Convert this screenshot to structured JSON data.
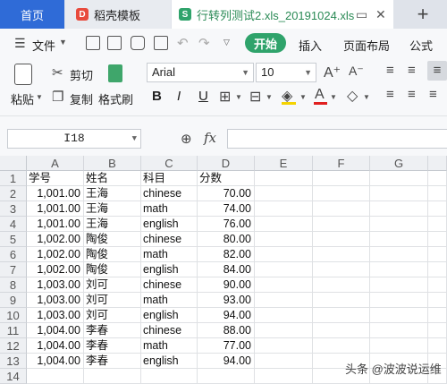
{
  "tabs": {
    "home": "首页",
    "templates": "稻壳模板",
    "file": "行转列测试2.xls_20191024.xls",
    "daoke_icon_text": "D",
    "sheet_icon_text": "S",
    "add": "+"
  },
  "menu": {
    "file": "文件",
    "start": "开始",
    "insert": "插入",
    "page_layout": "页面布局",
    "formula": "公式"
  },
  "ribbon": {
    "paste": "粘贴",
    "cut": "剪切",
    "copy": "复制",
    "format_painter": "格式刷",
    "font_name": "Arial",
    "font_size": "10",
    "bold": "B",
    "italic": "I",
    "underline": "U"
  },
  "formula_bar": {
    "cell_ref": "I18",
    "fx": "fx",
    "value": ""
  },
  "columns": [
    "A",
    "B",
    "C",
    "D",
    "E",
    "F",
    "G"
  ],
  "rows": [
    "1",
    "2",
    "3",
    "4",
    "5",
    "6",
    "7",
    "8",
    "9",
    "10",
    "11",
    "12",
    "13",
    "14"
  ],
  "sheet": [
    [
      "学号",
      "姓名",
      "科目",
      "分数"
    ],
    [
      "1,001.00",
      "王海",
      "chinese",
      "70.00"
    ],
    [
      "1,001.00",
      "王海",
      "math",
      "74.00"
    ],
    [
      "1,001.00",
      "王海",
      "english",
      "76.00"
    ],
    [
      "1,002.00",
      "陶俊",
      "chinese",
      "80.00"
    ],
    [
      "1,002.00",
      "陶俊",
      "math",
      "82.00"
    ],
    [
      "1,002.00",
      "陶俊",
      "english",
      "84.00"
    ],
    [
      "1,003.00",
      "刘可",
      "chinese",
      "90.00"
    ],
    [
      "1,003.00",
      "刘可",
      "math",
      "93.00"
    ],
    [
      "1,003.00",
      "刘可",
      "english",
      "94.00"
    ],
    [
      "1,004.00",
      "李春",
      "chinese",
      "88.00"
    ],
    [
      "1,004.00",
      "李春",
      "math",
      "77.00"
    ],
    [
      "1,004.00",
      "李春",
      "english",
      "94.00"
    ]
  ],
  "watermark": "头条 @波波说运维"
}
